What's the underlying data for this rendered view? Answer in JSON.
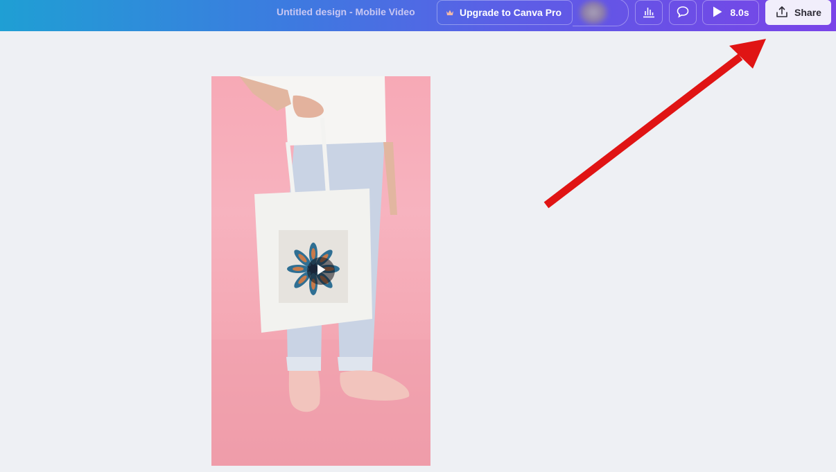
{
  "topbar": {
    "document_title": "Untitled design - Mobile Video",
    "upgrade_label": "Upgrade to Canva Pro",
    "duration_label": "8.0s",
    "share_label": "Share"
  },
  "icons": {
    "upgrade": "crown-icon",
    "analytics": "bar-chart-icon",
    "comment": "speech-bubble-icon",
    "play": "play-icon",
    "share": "upload-icon",
    "video_play": "play-icon"
  },
  "colors": {
    "topbar_gradient_start": "#1f9fd4",
    "topbar_gradient_end": "#7a44e8",
    "workspace_bg": "#eef0f4",
    "canvas_bg": "#f7a9b6",
    "annotation_arrow": "#e01414",
    "share_button_bg": "#f1eefb"
  }
}
